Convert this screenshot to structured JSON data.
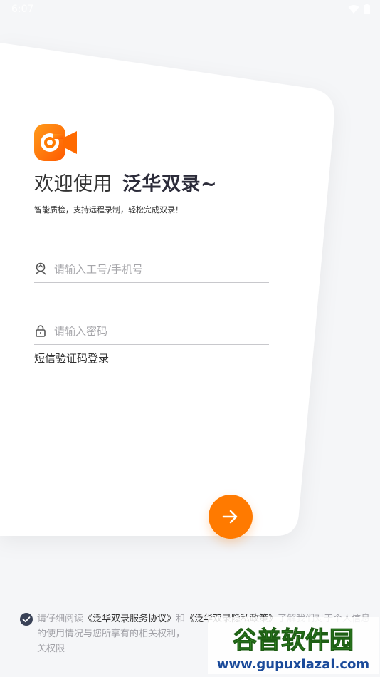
{
  "status": {
    "time": "6:07"
  },
  "logo": {
    "icon": "camera-logo-icon",
    "color": "#ff7a00"
  },
  "welcome": {
    "prefix": "欢迎使用",
    "brand": "泛华双录~"
  },
  "subtitle": "智能质检，支持远程录制，轻松完成双录！",
  "form": {
    "account": {
      "placeholder": "请输入工号/手机号",
      "value": "",
      "icon": "user-icon"
    },
    "password": {
      "placeholder": "请输入密码",
      "value": "",
      "icon": "lock-icon"
    },
    "sms_login_label": "短信验证码登录",
    "submit_icon": "arrow-right-icon"
  },
  "agreement": {
    "checked": true,
    "text_1": "请仔细阅读",
    "link_service": "《泛华双录服务协议》",
    "text_and": "和",
    "link_privacy": "《泛华双录隐私政策》",
    "text_2": "了解我们对于个人信息的使用情况与您所享有的相关权利，",
    "text_3": "关权限"
  },
  "watermark": {
    "title": "谷普软件园",
    "url": "www.gupuxlazal.com"
  },
  "colors": {
    "accent": "#ff7a00",
    "background": "#f5f6f8",
    "card": "#ffffff"
  }
}
